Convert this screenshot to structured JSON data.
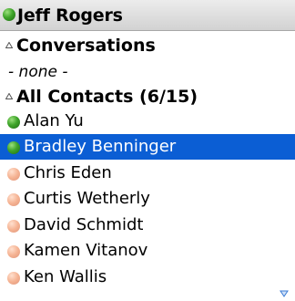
{
  "header": {
    "user_name": "Jeff Rogers",
    "status": "online",
    "status_icon": "presence-online-icon"
  },
  "sections": {
    "conversations": {
      "label": "Conversations",
      "expanded": true,
      "empty_text": "- none -"
    },
    "all_contacts": {
      "label": "All Contacts (6/15)",
      "expanded": true
    }
  },
  "contacts": [
    {
      "name": "Alan Yu",
      "status": "online"
    },
    {
      "name": "Bradley Benninger",
      "status": "online",
      "selected": true
    },
    {
      "name": "Chris Eden",
      "status": "offline"
    },
    {
      "name": "Curtis Wetherly",
      "status": "offline"
    },
    {
      "name": "David Schmidt",
      "status": "offline"
    },
    {
      "name": "Kamen Vitanov",
      "status": "offline"
    },
    {
      "name": "Ken Wallis",
      "status": "offline"
    }
  ],
  "scroll": {
    "more_below": true
  },
  "colors": {
    "selection": "#0b5ed4",
    "online": "#3fa52a",
    "offline": "#f5b393",
    "scroll_arrow": "#3a7bd5"
  }
}
